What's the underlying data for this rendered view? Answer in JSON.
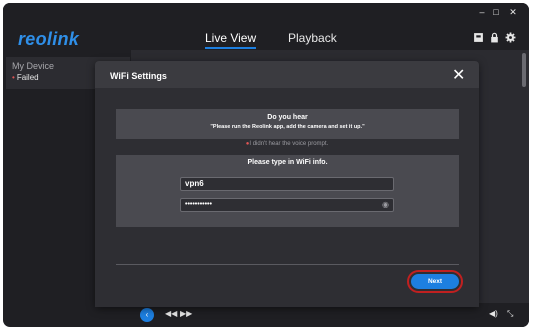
{
  "app": {
    "logo": "reolink"
  },
  "header": {
    "tabs": [
      {
        "label": "Live View"
      },
      {
        "label": "Playback"
      }
    ],
    "window_controls": {
      "minimize": "–",
      "maximize": "□",
      "close": "✕"
    }
  },
  "sidebar": {
    "title": "My Device",
    "device_status": "Failed"
  },
  "dialog": {
    "title": "WiFi Settings",
    "hear_title": "Do you hear",
    "hear_message": "\"Please run the Reolink app, add the camera and set it up.\"",
    "no_hear": "I didn't hear the voice prompt.",
    "wifi_title": "Please type in WiFi info.",
    "ssid_value": "vpn6",
    "password_value": "•••••••••••",
    "next_label": "Next"
  },
  "colors": {
    "accent": "#1d7fe0",
    "highlight": "#c02020"
  }
}
